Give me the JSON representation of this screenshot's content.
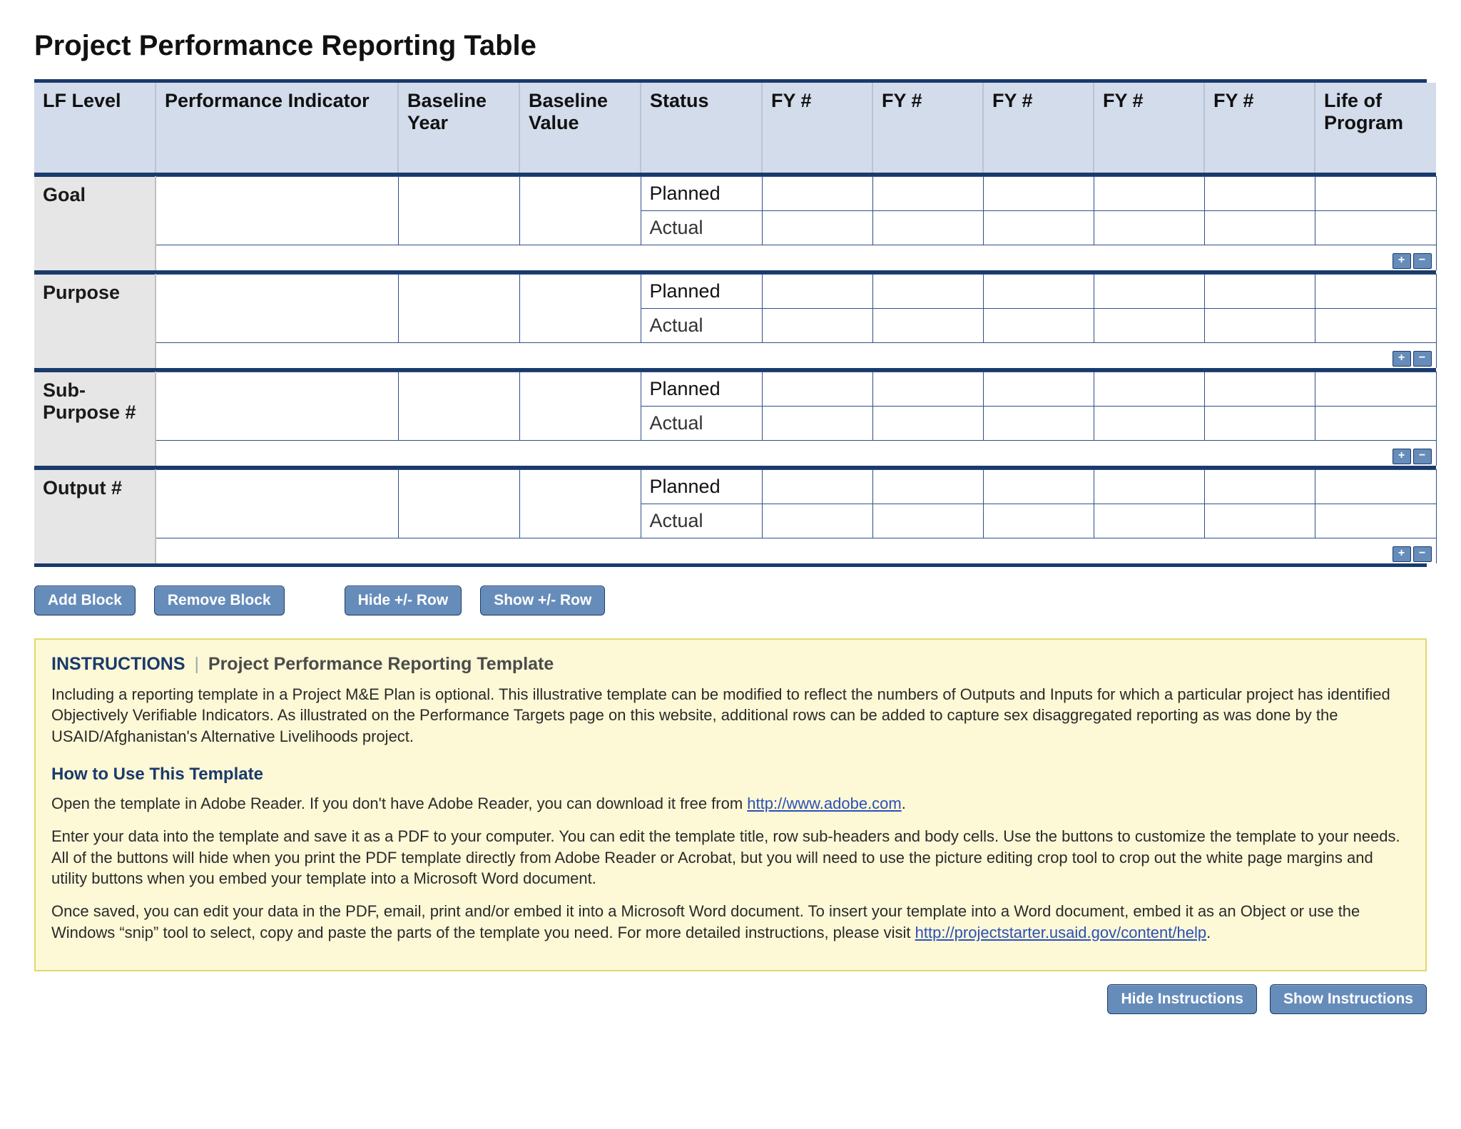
{
  "title": "Project Performance Reporting Table",
  "columns": {
    "lf_level": "LF Level",
    "pi": "Performance Indicator",
    "baseline_year": "Baseline Year",
    "baseline_value": "Baseline Value",
    "status": "Status",
    "fy1": "FY #",
    "fy2": "FY #",
    "fy3": "FY #",
    "fy4": "FY #",
    "fy5": "FY #",
    "lop": "Life of Program"
  },
  "status_labels": {
    "planned": "Planned",
    "actual": "Actual"
  },
  "sections": [
    {
      "key": "goal",
      "label": "Goal"
    },
    {
      "key": "purpose",
      "label": "Purpose"
    },
    {
      "key": "subpurpose",
      "label": "Sub-Purpose #"
    },
    {
      "key": "output",
      "label": "Output #"
    }
  ],
  "pm": {
    "plus": "+",
    "minus": "−"
  },
  "buttons": {
    "add_block": "Add Block",
    "remove_block": "Remove Block",
    "hide_row": "Hide +/- Row",
    "show_row": "Show +/- Row",
    "hide_instructions": "Hide Instructions",
    "show_instructions": "Show Instructions"
  },
  "instructions": {
    "lead": "INSTRUCTIONS",
    "subtitle": "Project Performance Reporting Template",
    "para1": "Including a reporting template in a Project M&E Plan is optional. This illustrative template can be modified to reflect the numbers of Outputs and Inputs for which a particular project has identified Objectively Verifiable Indicators. As illustrated on the Performance Targets page on this website, additional rows can be added to capture sex disaggregated reporting as was done by the USAID/Afghanistan's Alternative Livelihoods project.",
    "howto_title": "How to Use This Template",
    "howto_p1_a": "Open the template in Adobe Reader. If you don't have Adobe Reader, you can download it free from ",
    "howto_p1_link": "http://www.adobe.com",
    "howto_p1_b": ".",
    "howto_p2": "Enter your data into the template and save it as a PDF to your computer. You can edit the template title, row sub-headers and body cells. Use the buttons to customize the template to your needs. All of the buttons will hide when you print the PDF template directly from Adobe Reader or Acrobat, but you will need to use the picture editing crop tool to crop out the white page margins and utility buttons when you embed your template into a Microsoft Word document.",
    "howto_p3_a": "Once saved, you can edit your data in the PDF, email, print and/or embed it into a Microsoft Word document. To insert your template into a Word document, embed it as an Object or use the Windows “snip” tool to select, copy and paste the parts of the template you need. For more detailed instructions, please visit ",
    "howto_p3_link": "http://projectstarter.usaid.gov/content/help",
    "howto_p3_b": "."
  }
}
